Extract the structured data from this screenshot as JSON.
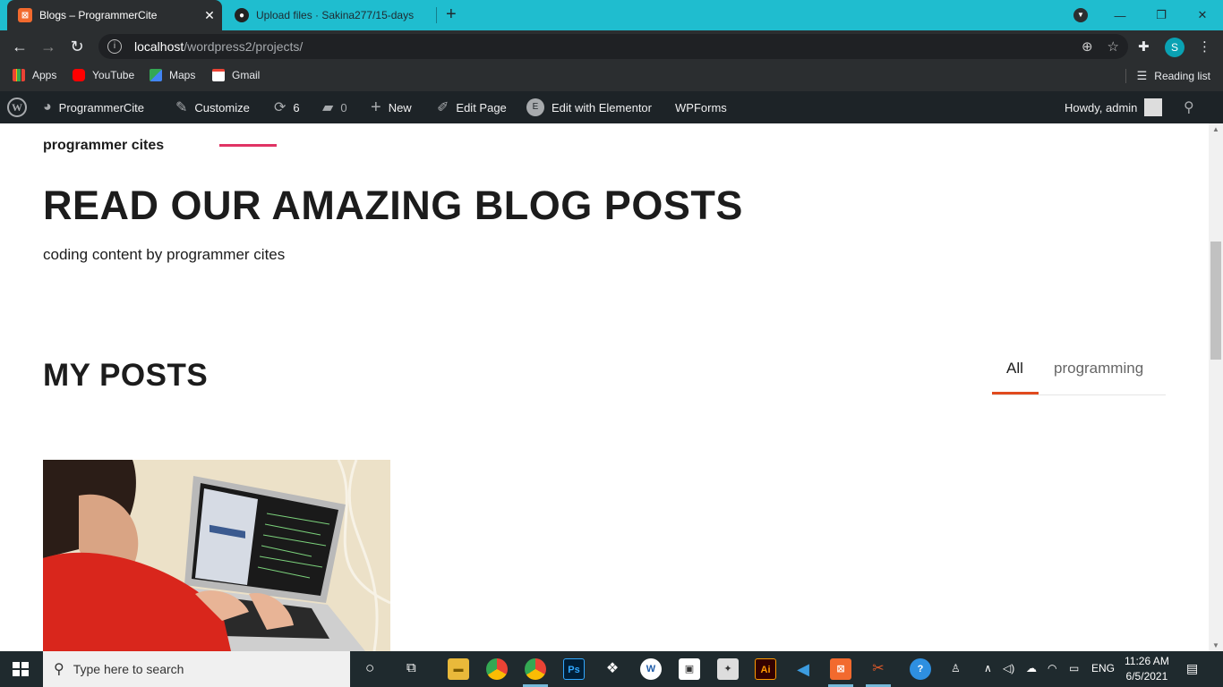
{
  "browser": {
    "tabs": [
      {
        "title": "Blogs – ProgrammerCite",
        "favicon": "xampp-icon"
      },
      {
        "title": "Upload files · Sakina277/15-days",
        "favicon": "github-icon"
      }
    ],
    "new_tab": "+",
    "url_host": "localhost",
    "url_path": "/wordpress2/projects/",
    "profile_initial": "S",
    "bookmarks": [
      "Apps",
      "YouTube",
      "Maps",
      "Gmail"
    ],
    "reading_list": "Reading list"
  },
  "wp_admin_bar": {
    "site_name": "ProgrammerCite",
    "customize": "Customize",
    "updates_count": "6",
    "comments_count": "0",
    "new": "New",
    "edit_page": "Edit Page",
    "edit_elementor": "Edit with Elementor",
    "wpforms": "WPForms",
    "howdy": "Howdy, admin"
  },
  "page": {
    "brand": "programmer cites",
    "hero_title": "READ OUR AMAZING BLOG POSTS",
    "subtitle": "coding content by programmer cites",
    "section_title": "MY POSTS",
    "filters": [
      "All",
      "programming"
    ],
    "active_filter": "All"
  },
  "taskbar": {
    "search_placeholder": "Type here to search",
    "language": "ENG",
    "time": "11:26 AM",
    "date": "6/5/2021"
  },
  "colors": {
    "tab_strip": "#1fbdcf",
    "chrome_dark": "#2b2e30",
    "wp_bar": "#1d2327",
    "accent_line": "#e03464",
    "filter_underline": "#e04a1e",
    "taskbar": "#1f2a2e"
  }
}
